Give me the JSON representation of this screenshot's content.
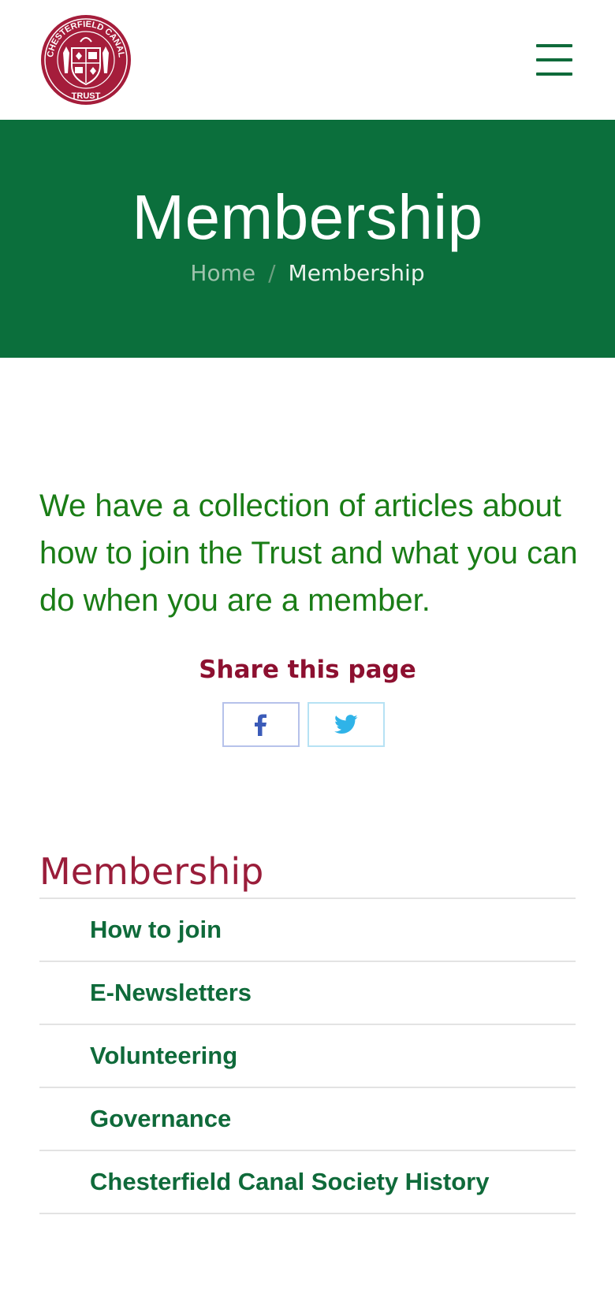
{
  "header": {
    "logo_alt": "Chesterfield Canal Trust",
    "logo_text_top": "CHESTERFIELD CANAL",
    "logo_text_bottom": "TRUST",
    "menu_icon": "hamburger-menu-icon"
  },
  "hero": {
    "title": "Membership",
    "breadcrumb": {
      "home": "Home",
      "separator": "/",
      "current": "Membership"
    }
  },
  "intro": {
    "text": "We have a collection of articles about how to join the Trust and what you can do when you are a member."
  },
  "share": {
    "title": "Share this page",
    "facebook_icon": "facebook-icon",
    "twitter_icon": "twitter-icon"
  },
  "sidebar": {
    "title": "Membership",
    "items": [
      {
        "label": "How to join"
      },
      {
        "label": "E-Newsletters"
      },
      {
        "label": "Volunteering"
      },
      {
        "label": "Governance"
      },
      {
        "label": "Chesterfield Canal Society History"
      }
    ]
  },
  "colors": {
    "brand_green": "#0b6f3c",
    "intro_green": "#1a7d16",
    "brand_maroon": "#9a1d3a",
    "logo_red": "#a51d3b"
  }
}
